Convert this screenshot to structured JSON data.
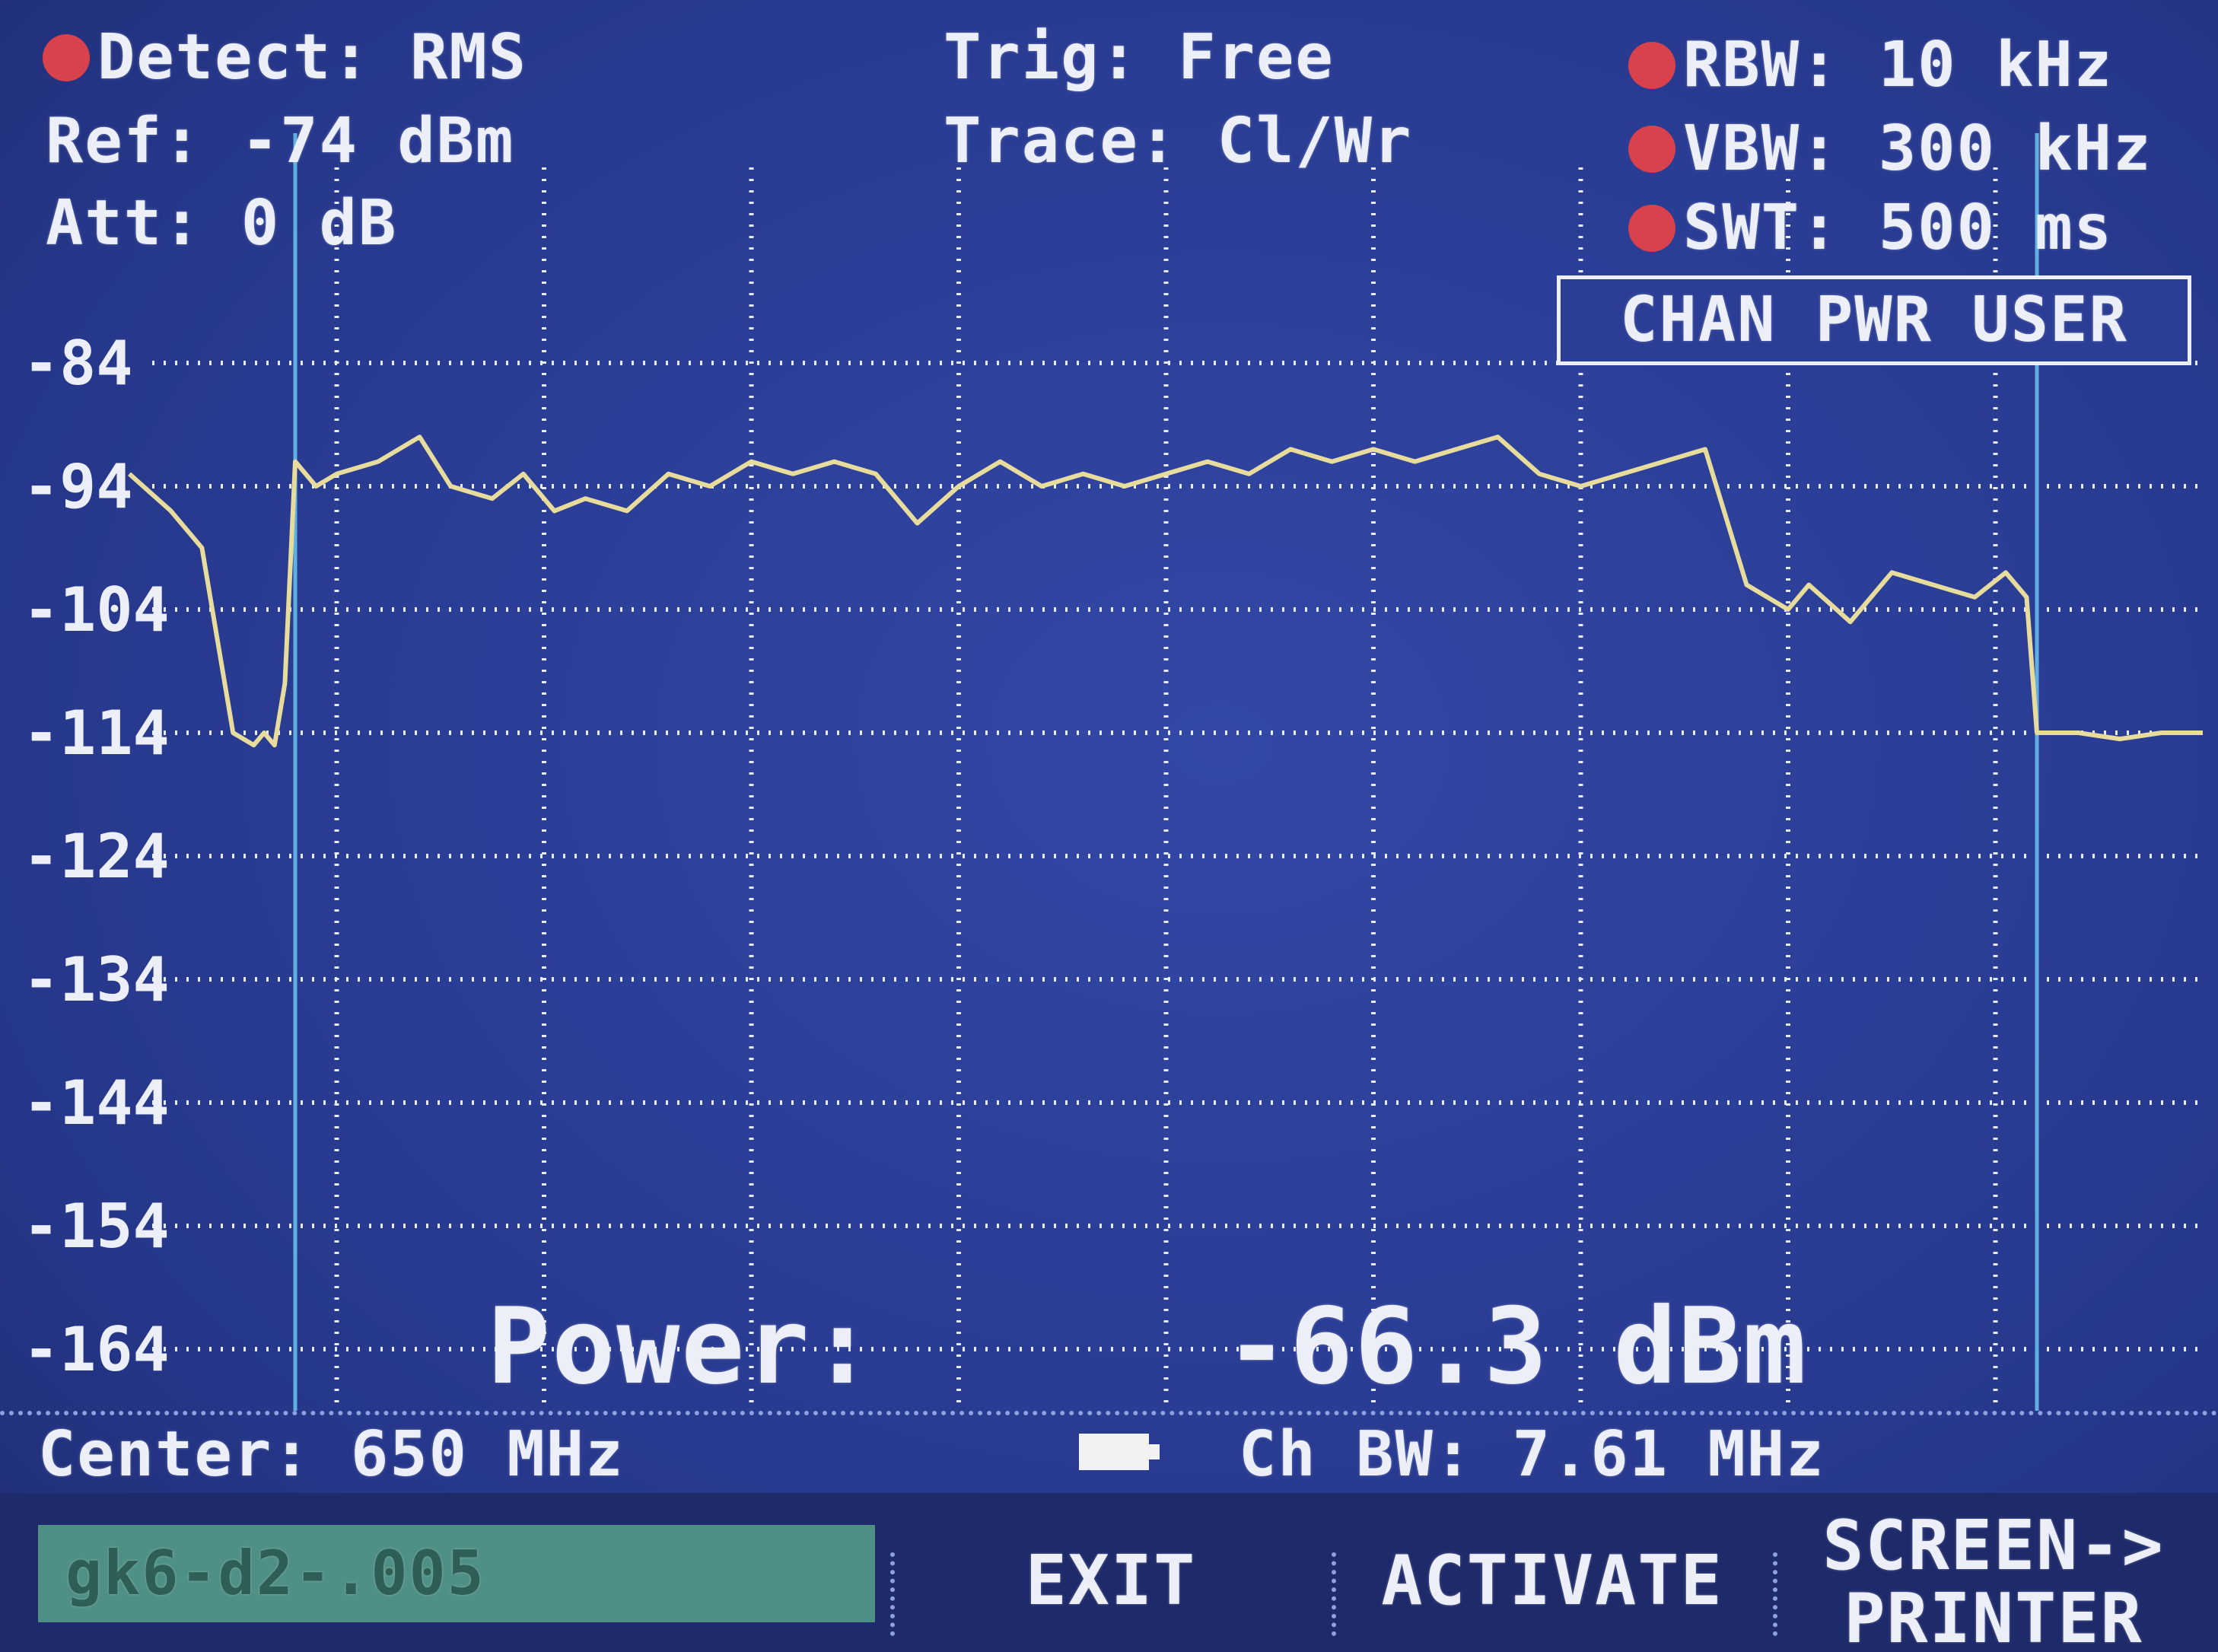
{
  "header": {
    "detect": "Detect: RMS",
    "ref": "Ref: -74 dBm",
    "att": "Att: 0 dB",
    "trig": "Trig: Free",
    "trace": "Trace: Cl/Wr",
    "rbw": "RBW: 10 kHz",
    "vbw": "VBW: 300 kHz",
    "swt": "SWT: 500 ms",
    "indicator_color": "#d9414c"
  },
  "mode": "CHAN PWR USER",
  "measurement": {
    "power_label": "Power:",
    "power_value": "-66.3 dBm"
  },
  "footer": {
    "center": "Center: 650 MHz",
    "ch_bw": "Ch BW: 7.61 MHz",
    "battery_icon": "battery-icon"
  },
  "bottom_bar": {
    "filename": "gk6-d2-.005",
    "exit": "EXIT",
    "activate": "ACTIVATE",
    "screen_printer_line1": "SCREEN->",
    "screen_printer_line2": "PRINTER"
  },
  "chart_data": {
    "type": "line",
    "ylabel": "",
    "xlabel": "",
    "y_ticks": [
      "-84",
      "-94",
      "-104",
      "-114",
      "-124",
      "-134",
      "-144",
      "-154",
      "-164"
    ],
    "ylim": [
      -169,
      -79
    ],
    "x_divisions": 10,
    "grid": true,
    "channel_markers_division": [
      0.8,
      9.2
    ],
    "trace_color": "#e8dc9c",
    "marker_color": "#5fb0e0",
    "series": [
      {
        "x": [
          0.0,
          0.2,
          0.35,
          0.5,
          0.55,
          0.6,
          0.65,
          0.7,
          0.75,
          0.8,
          0.9,
          1.0,
          1.2,
          1.4,
          1.55,
          1.75,
          1.9,
          2.05,
          2.2,
          2.4,
          2.6,
          2.8,
          3.0,
          3.2,
          3.4,
          3.6,
          3.8,
          4.0,
          4.2,
          4.4,
          4.6,
          4.8,
          5.0,
          5.2,
          5.4,
          5.6,
          5.8,
          6.0,
          6.2,
          6.4,
          6.6,
          6.8,
          7.0,
          7.2,
          7.4,
          7.6,
          7.8,
          8.0,
          8.1,
          8.3,
          8.5,
          8.7,
          8.9,
          9.05,
          9.15,
          9.2,
          9.25,
          9.4,
          9.6,
          9.8,
          10.0
        ],
        "values": [
          -93,
          -96,
          -99,
          -114,
          -114.5,
          -115,
          -114,
          -115,
          -110,
          -92,
          -94,
          -93,
          -92,
          -90,
          -94,
          -95,
          -93,
          -96,
          -95,
          -96,
          -93,
          -94,
          -92,
          -93,
          -92,
          -93,
          -97,
          -94,
          -92,
          -94,
          -93,
          -94,
          -93,
          -92,
          -93,
          -91,
          -92,
          -91,
          -92,
          -91,
          -90,
          -93,
          -94,
          -93,
          -92,
          -91,
          -102,
          -104,
          -102,
          -105,
          -101,
          -102,
          -103,
          -101,
          -103,
          -114,
          -114,
          -114,
          -114.5,
          -114,
          -114
        ]
      }
    ]
  }
}
